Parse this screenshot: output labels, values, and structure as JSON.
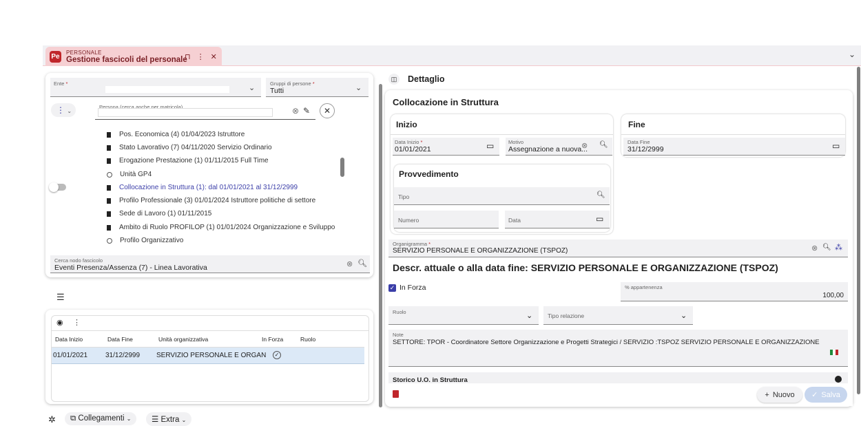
{
  "tab": {
    "module": "PERSONALE",
    "title": "Gestione fascicoli del personale",
    "logo_text": "Pe"
  },
  "left": {
    "ente_label": "Ente",
    "gruppi_label": "Gruppi di persone",
    "gruppi_value": "Tutti",
    "persona_placeholder": "Persona (cerca anche per matricola)",
    "tree": [
      {
        "icon": "document",
        "text": "Pos. Economica (4) 01/04/2023  Istruttore"
      },
      {
        "icon": "document",
        "text": "Stato Lavorativo (7) 04/11/2020  Servizio Ordinario"
      },
      {
        "icon": "document",
        "text": "Erogazione Prestazione (1) 01/11/2015  Full Time"
      },
      {
        "icon": "circle",
        "text": "Unità GP4"
      },
      {
        "icon": "document",
        "text": "Collocazione in Struttura (1): dal 01/01/2021 al 31/12/2999"
      },
      {
        "icon": "document",
        "text": "Profilo Professionale (3) 01/01/2024  Istruttore politiche di settore"
      },
      {
        "icon": "document",
        "text": "Sede di Lavoro (1) 01/11/2015"
      },
      {
        "icon": "document",
        "text": "Ambito di Ruolo PROFILOP (1) 01/01/2024  Organizzazione e Sviluppo"
      },
      {
        "icon": "circle",
        "text": "Profilo Organizzativo"
      }
    ],
    "cerca_label": "Cerca nodo fascicolo",
    "cerca_value": "Eventi Presenza/Assenza (7) - Linea Lavorativa"
  },
  "grid": {
    "columns": [
      "Data Inizio",
      "Data Fine",
      "Unità organizzativa",
      "In Forza",
      "Ruolo"
    ],
    "rows": [
      {
        "data_inizio": "01/01/2021",
        "data_fine": "31/12/2999",
        "unita": "SERVIZIO PERSONALE E ORGAN",
        "in_forza": "✓",
        "ruolo": ""
      }
    ]
  },
  "footer": {
    "collegamenti": "Collegamenti",
    "extra": "Extra"
  },
  "detail": {
    "header": "Dettaglio",
    "section_title": "Collocazione in Struttura",
    "inizio_title": "Inizio",
    "fine_title": "Fine",
    "data_inizio_label": "Data Inizio",
    "data_inizio_value": "01/01/2021",
    "motivo_label": "Motivo",
    "motivo_value": "Assegnazione a nuova...",
    "data_fine_label": "Data Fine",
    "data_fine_value": "31/12/2999",
    "provvedimento_title": "Provvedimento",
    "tipo_placeholder": "Tipo",
    "numero_placeholder": "Numero",
    "data_placeholder": "Data",
    "organigramma_label": "Organigramma",
    "organigramma_value": "SERVIZIO PERSONALE E ORGANIZZAZIONE (TSPOZ)",
    "descr": "Descr. attuale o alla data fine: SERVIZIO PERSONALE E ORGANIZZAZIONE (TSPOZ)",
    "in_forza_label": "In Forza",
    "appartenenza_label": "% appartenenza",
    "appartenenza_value": "100,00",
    "ruolo_label": "Ruolo",
    "tipo_relazione_label": "Tipo relazione",
    "note_label": "Note",
    "note_value": "SETTORE: TPOR - Coordinatore Settore Organizzazione e Progetti Strategici / SERVIZIO :TSPOZ SERVIZIO PERSONALE E ORGANIZZAZIONE",
    "storico_label": "Storico U.O. in Struttura",
    "nuovo_label": "Nuovo",
    "salva_label": "Salva"
  },
  "colors": {
    "brand": "#c0262b",
    "tab_bg": "#f6d0d3",
    "selected_row": "#dce9f7",
    "active_link": "#3b3ea8"
  }
}
